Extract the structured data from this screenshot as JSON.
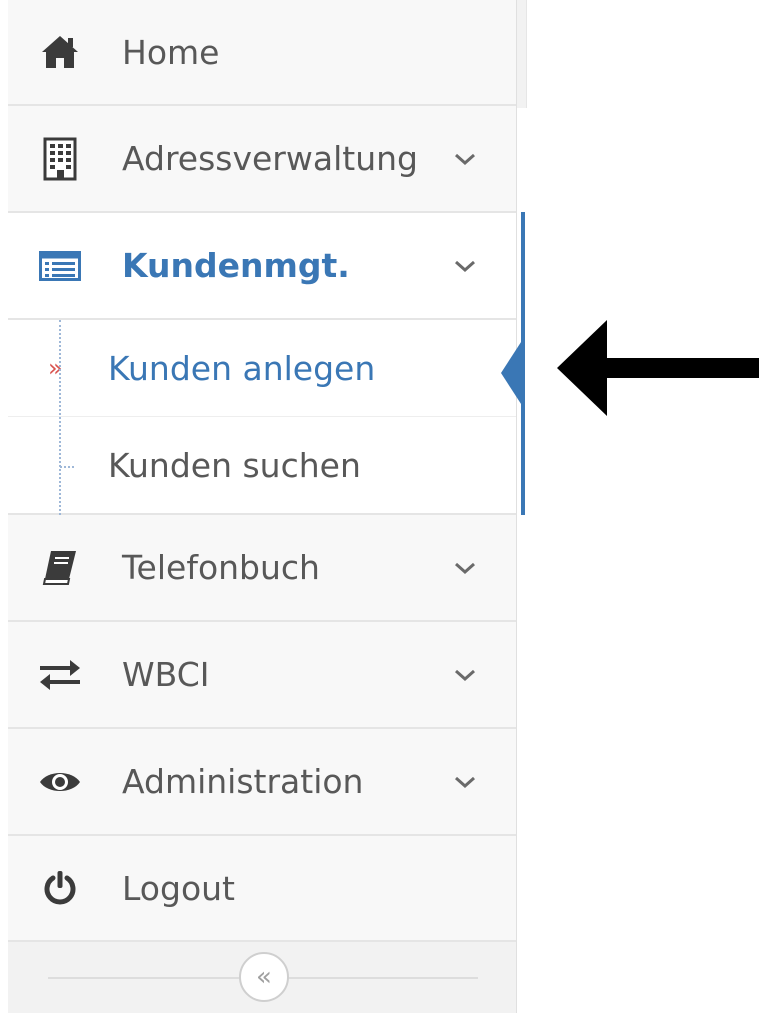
{
  "nav": {
    "home": {
      "label": "Home",
      "icon": "home-icon"
    },
    "adressverwaltung": {
      "label": "Adressverwaltung",
      "icon": "building-icon"
    },
    "kundenmgt": {
      "label": "Kundenmgt.",
      "icon": "list-icon"
    },
    "telefonbuch": {
      "label": "Telefonbuch",
      "icon": "book-icon"
    },
    "wbci": {
      "label": "WBCI",
      "icon": "exchange-icon"
    },
    "administration": {
      "label": "Administration",
      "icon": "eye-icon"
    },
    "logout": {
      "label": "Logout",
      "icon": "power-icon"
    }
  },
  "submenu": {
    "kunden_anlegen": {
      "label": "Kunden anlegen",
      "marker": "»"
    },
    "kunden_suchen": {
      "label": "Kunden suchen"
    }
  },
  "collapse": {
    "label": "«"
  },
  "colors": {
    "accent": "#3a77b5",
    "marker": "#d9534f",
    "text": "#585858"
  }
}
